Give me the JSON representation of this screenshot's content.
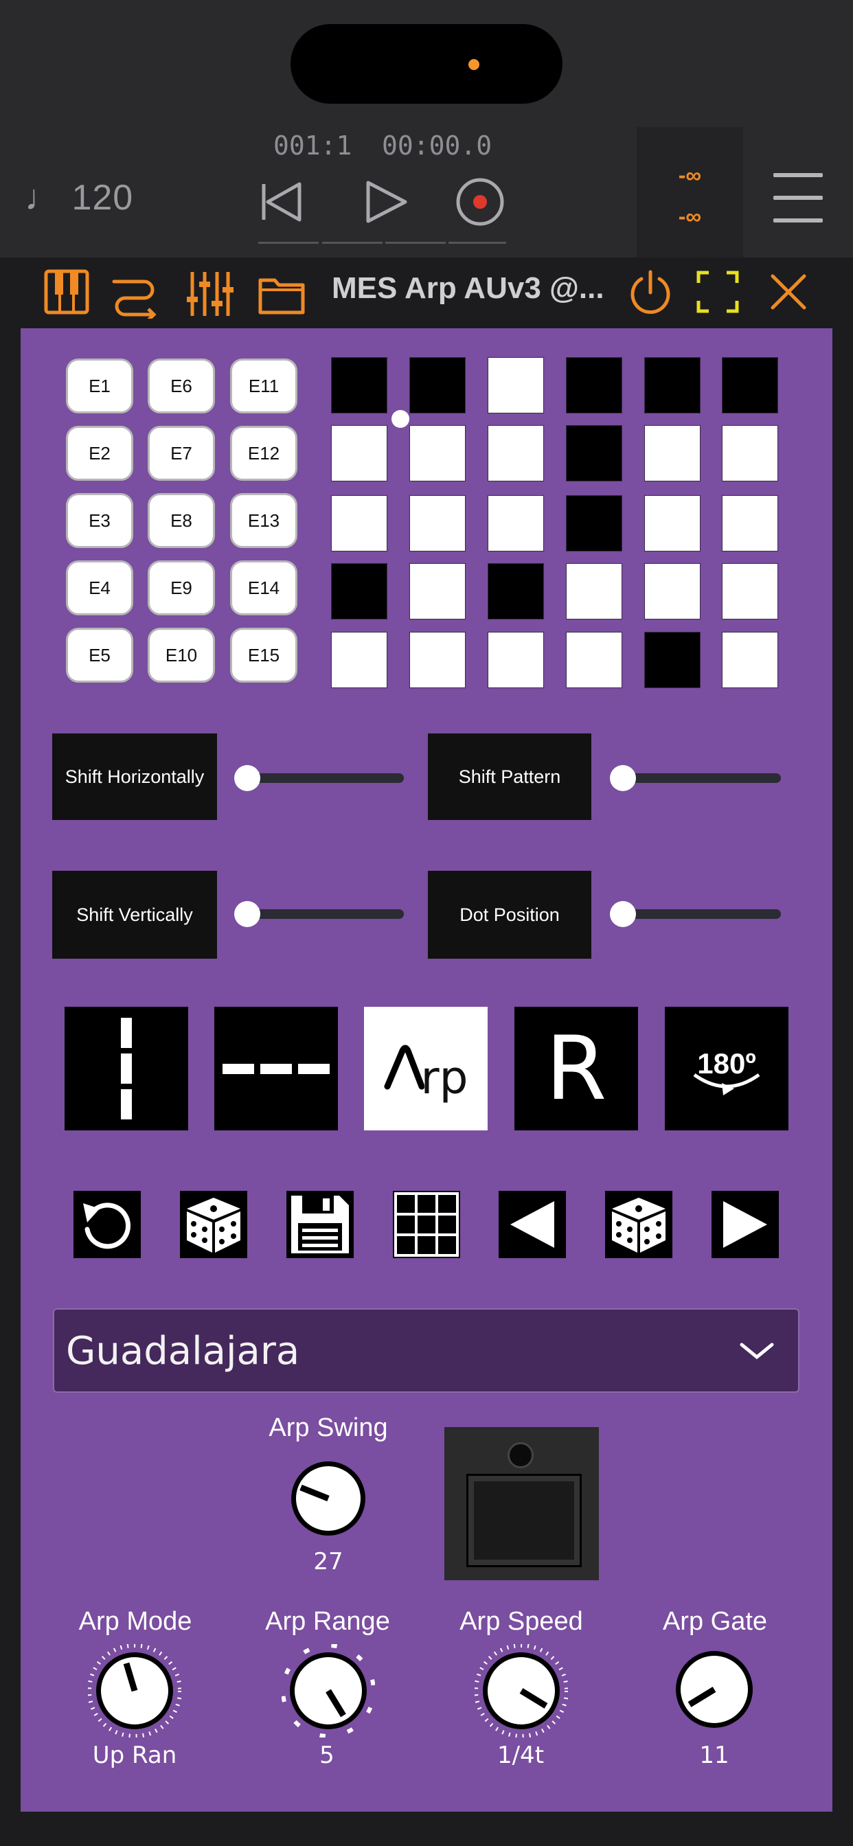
{
  "host": {
    "tempo": "♩ 120",
    "bar_position": "001:1",
    "time_position": "00:00.0",
    "meter_top": "-∞",
    "meter_bottom": "-∞"
  },
  "plugin": {
    "title": "MES Arp AUv3 @...",
    "accent_color": "#f08a24",
    "panel_color": "#7a4ea0"
  },
  "euclid_buttons": [
    "E1",
    "E6",
    "E11",
    "E2",
    "E7",
    "E12",
    "E3",
    "E8",
    "E13",
    "E4",
    "E9",
    "E14",
    "E5",
    "E10",
    "E15"
  ],
  "pattern_grid": [
    [
      1,
      1,
      0,
      1,
      1,
      1
    ],
    [
      0,
      0,
      0,
      1,
      0,
      0
    ],
    [
      0,
      0,
      0,
      1,
      0,
      0
    ],
    [
      1,
      0,
      1,
      0,
      0,
      0
    ],
    [
      0,
      0,
      0,
      0,
      1,
      0
    ]
  ],
  "controls": {
    "shift_horizontally": "Shift Horizontally",
    "shift_pattern": "Shift Pattern",
    "shift_vertically": "Shift Vertically",
    "dot_position": "Dot Position"
  },
  "mode_buttons": {
    "arp_logo_text": "rp",
    "reverse_label": "R",
    "rotate_label": "180º"
  },
  "preset": {
    "selected": "Guadalajara"
  },
  "knobs": {
    "arp_swing": {
      "label": "Arp Swing",
      "value": "27"
    },
    "arp_mode": {
      "label": "Arp Mode",
      "value": "Up Ran"
    },
    "arp_range": {
      "label": "Arp Range",
      "value": "5"
    },
    "arp_speed": {
      "label": "Arp Speed",
      "value": "1/4t"
    },
    "arp_gate": {
      "label": "Arp Gate",
      "value": "11"
    }
  }
}
